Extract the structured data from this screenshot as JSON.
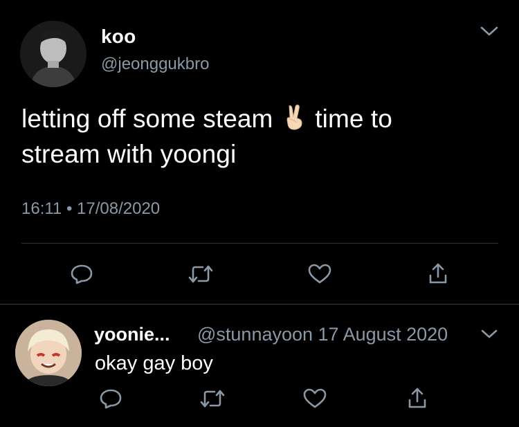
{
  "tweet": {
    "display_name": "koo",
    "handle": "@jeonggukbro",
    "text_before_emoji": "letting off some steam ",
    "emoji": "victory-hand",
    "text_after_emoji": " time to stream with yoongi",
    "timestamp": "16:11 • 17/08/2020"
  },
  "actions": [
    "reply",
    "retweet",
    "like",
    "share"
  ],
  "reply": {
    "display_name": "yoonie...",
    "handle_and_date": "@stunnayoon 17 August 2020",
    "text": "okay gay boy"
  },
  "colors": {
    "background": "#000000",
    "text": "#ffffff",
    "secondary_text": "#8b98a5",
    "divider": "#2f3336"
  }
}
